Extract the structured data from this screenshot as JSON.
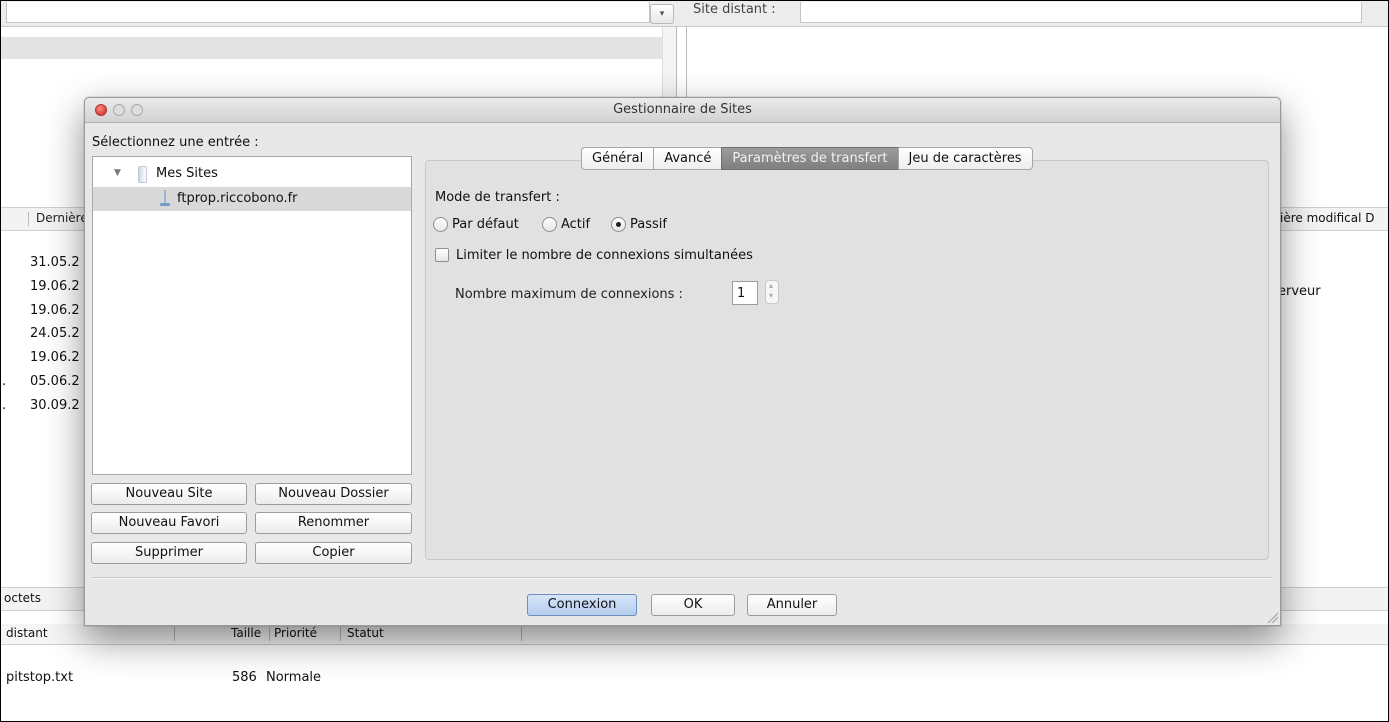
{
  "background": {
    "remote_site_label": "Site distant :",
    "dropdown_glyph": "▾",
    "local_list_header": "Dernière",
    "local_dates": [
      "31.05.2",
      "19.06.2",
      "19.06.2",
      "24.05.2",
      "19.06.2",
      "05.06.2",
      "30.09.2"
    ],
    "local_dots": [
      ".",
      "."
    ],
    "remote_list_header": "ière modifical D",
    "remote_cell": "erveur",
    "octets_label": "octets",
    "queue": {
      "col_distant": "distant",
      "col_size": "Taille",
      "col_priority": "Priorité",
      "col_status": "Statut",
      "row": {
        "name": "pitstop.txt",
        "size": "586",
        "priority": "Normale"
      }
    }
  },
  "dialog": {
    "title": "Gestionnaire de Sites",
    "select_label": "Sélectionnez une entrée :",
    "tree": {
      "folder": "Mes Sites",
      "site": "ftprop.riccobono.fr"
    },
    "buttons": {
      "new_site": "Nouveau Site",
      "new_folder": "Nouveau Dossier",
      "new_bookmark": "Nouveau Favori",
      "rename": "Renommer",
      "delete": "Supprimer",
      "copy": "Copier"
    },
    "tabs": [
      "Général",
      "Avancé",
      "Paramètres de transfert",
      "Jeu de caractères"
    ],
    "active_tab": "Paramètres de transfert",
    "transfer": {
      "mode_label": "Mode de transfert :",
      "mode_options": [
        "Par défaut",
        "Actif",
        "Passif"
      ],
      "selected_mode": "Passif",
      "limit_label": "Limiter le nombre de connexions simultanées",
      "limit_checked": false,
      "max_label": "Nombre maximum de connexions :",
      "max_value": "1"
    },
    "footer": {
      "connect": "Connexion",
      "ok": "OK",
      "cancel": "Annuler"
    }
  },
  "colors": {
    "dialog_bg": "#e8e8e8",
    "active_tab": "#8f8f8f",
    "default_button": "#b4cdef",
    "close_button": "#d6423b"
  }
}
